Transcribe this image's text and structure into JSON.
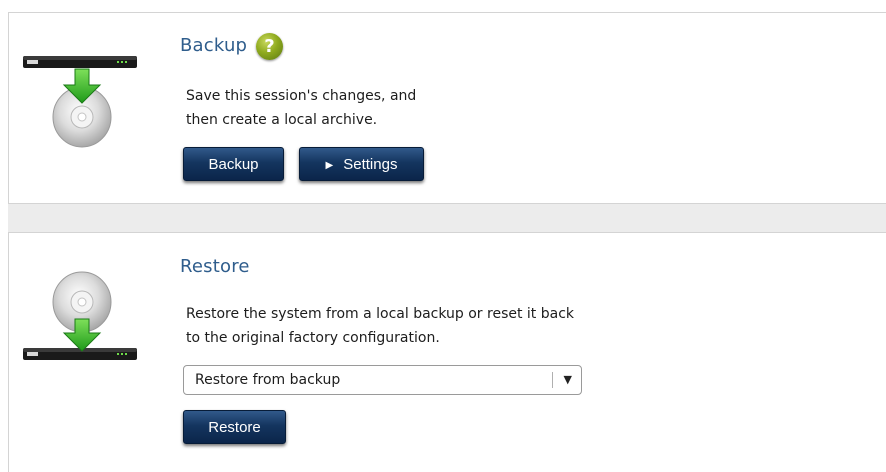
{
  "backup": {
    "title": "Backup",
    "help_symbol": "?",
    "description_line1": "Save this session's changes, and",
    "description_line2": "then create a local archive.",
    "backup_button_label": "Backup",
    "settings_button_label": "Settings",
    "settings_icon": "play-triangle-icon",
    "illustration": "disc-download-icon"
  },
  "restore": {
    "title": "Restore",
    "description_line1": "Restore the system from a local backup or reset it back",
    "description_line2": "to the original factory configuration.",
    "select_value": "Restore from backup",
    "select_arrow": "▼",
    "restore_button_label": "Restore",
    "illustration": "disc-upload-icon"
  },
  "colors": {
    "title_blue": "#2f5d8c",
    "button_navy": "#14355f",
    "arrow_green": "#4cc23a",
    "help_green": "#8faa1e"
  }
}
